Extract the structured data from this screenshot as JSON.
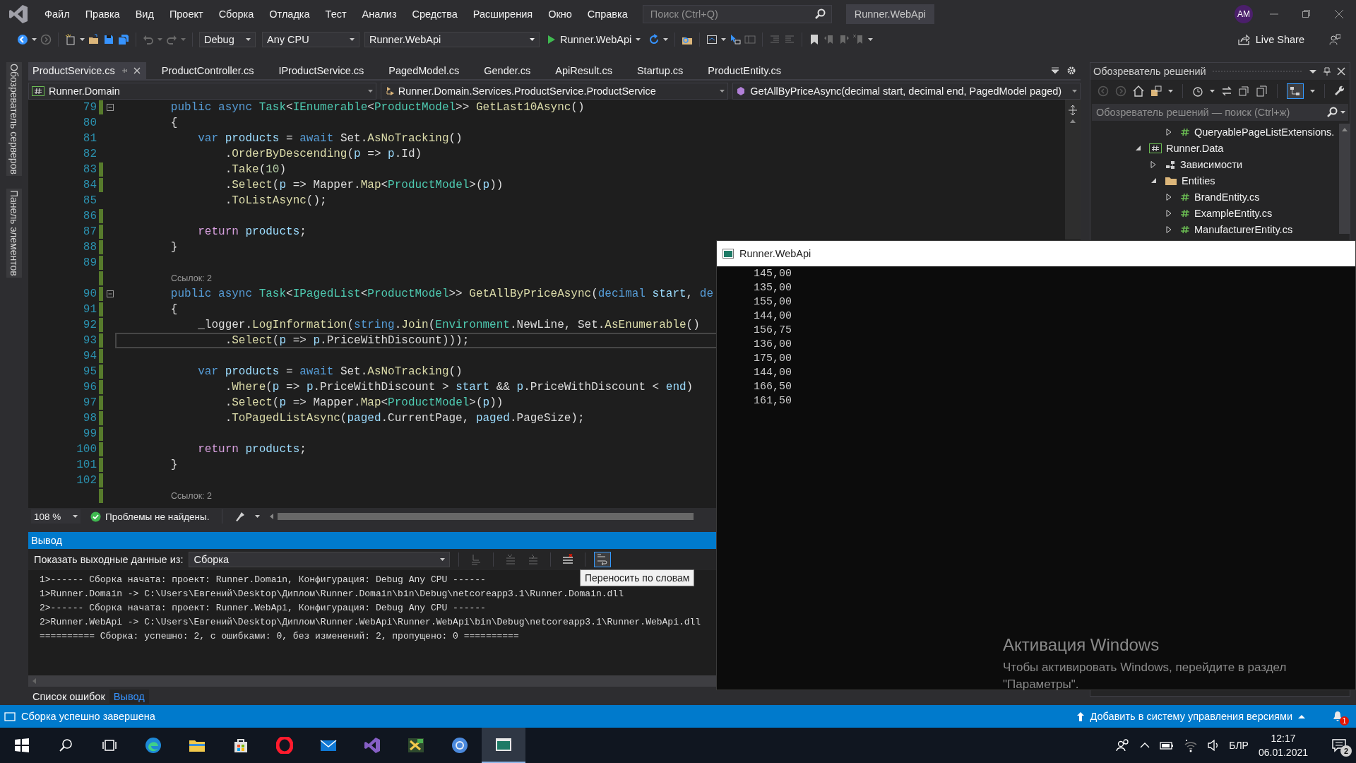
{
  "menu_bar": {
    "items": [
      "Файл",
      "Правка",
      "Вид",
      "Проект",
      "Сборка",
      "Отладка",
      "Тест",
      "Анализ",
      "Средства",
      "Расширения",
      "Окно",
      "Справка"
    ],
    "search": {
      "placeholder": "Поиск (Ctrl+Q)"
    },
    "solution_name": "Runner.WebApi",
    "avatar": "AM"
  },
  "toolbar": {
    "configuration": "Debug",
    "platform": "Any CPU",
    "startup_project": "Runner.WebApi",
    "run_target": "Runner.WebApi",
    "live_share": "Live Share"
  },
  "side_strip": [
    "Обозреватель серверов",
    "Панель элементов"
  ],
  "editor": {
    "tabs": [
      {
        "label": "ProductService.cs",
        "selected": true
      },
      {
        "label": "ProductController.cs",
        "selected": false
      },
      {
        "label": "IProductService.cs",
        "selected": false
      },
      {
        "label": "PagedModel.cs",
        "selected": false
      },
      {
        "label": "Gender.cs",
        "selected": false
      },
      {
        "label": "ApiResult.cs",
        "selected": false
      },
      {
        "label": "Startup.cs",
        "selected": false
      },
      {
        "label": "ProductEntity.cs",
        "selected": false
      }
    ],
    "nav": {
      "project": "Runner.Domain",
      "type": "Runner.Domain.Services.ProductService.ProductService",
      "member": "GetAllByPriceAsync(decimal start, decimal end, PagedModel paged)"
    },
    "lines": [
      {
        "kind": "code",
        "number": "79",
        "changed": true,
        "current": false,
        "foldable": true,
        "tokens": [
          {
            "kind": "kw",
            "text": "        public"
          },
          {
            "kind": "kw",
            "text": " async"
          },
          {
            "kind": "type",
            "text": " Task"
          },
          {
            "kind": "plain",
            "text": "<"
          },
          {
            "kind": "type",
            "text": "IEnumerable"
          },
          {
            "kind": "plain",
            "text": "<"
          },
          {
            "kind": "type",
            "text": "ProductModel"
          },
          {
            "kind": "plain",
            "text": ">> "
          },
          {
            "kind": "method",
            "text": "GetLast10Async"
          },
          {
            "kind": "plain",
            "text": "()"
          }
        ]
      },
      {
        "kind": "code",
        "number": "80",
        "changed": false,
        "current": false,
        "foldable": false,
        "tokens": [
          {
            "kind": "plain",
            "text": "        {"
          }
        ]
      },
      {
        "kind": "code",
        "number": "81",
        "changed": false,
        "current": false,
        "foldable": false,
        "tokens": [
          {
            "kind": "kw",
            "text": "            var"
          },
          {
            "kind": "ident",
            "text": " products"
          },
          {
            "kind": "plain",
            "text": " = "
          },
          {
            "kind": "kw",
            "text": "await"
          },
          {
            "kind": "plain",
            "text": " Set."
          },
          {
            "kind": "method",
            "text": "AsNoTracking"
          },
          {
            "kind": "plain",
            "text": "()"
          }
        ]
      },
      {
        "kind": "code",
        "number": "82",
        "changed": false,
        "current": false,
        "foldable": false,
        "tokens": [
          {
            "kind": "plain",
            "text": "                ."
          },
          {
            "kind": "method",
            "text": "OrderByDescending"
          },
          {
            "kind": "plain",
            "text": "("
          },
          {
            "kind": "ident",
            "text": "p"
          },
          {
            "kind": "plain",
            "text": " => "
          },
          {
            "kind": "ident",
            "text": "p"
          },
          {
            "kind": "plain",
            "text": ".Id)"
          }
        ]
      },
      {
        "kind": "code",
        "number": "83",
        "changed": true,
        "current": false,
        "foldable": false,
        "tokens": [
          {
            "kind": "plain",
            "text": "                ."
          },
          {
            "kind": "method",
            "text": "Take"
          },
          {
            "kind": "plain",
            "text": "("
          },
          {
            "kind": "num",
            "text": "10"
          },
          {
            "kind": "plain",
            "text": ")"
          }
        ]
      },
      {
        "kind": "code",
        "number": "84",
        "changed": true,
        "current": false,
        "foldable": false,
        "tokens": [
          {
            "kind": "plain",
            "text": "                ."
          },
          {
            "kind": "method",
            "text": "Select"
          },
          {
            "kind": "plain",
            "text": "("
          },
          {
            "kind": "ident",
            "text": "p"
          },
          {
            "kind": "plain",
            "text": " => Mapper."
          },
          {
            "kind": "method",
            "text": "Map"
          },
          {
            "kind": "plain",
            "text": "<"
          },
          {
            "kind": "type",
            "text": "ProductModel"
          },
          {
            "kind": "plain",
            "text": ">("
          },
          {
            "kind": "ident",
            "text": "p"
          },
          {
            "kind": "plain",
            "text": "))"
          }
        ]
      },
      {
        "kind": "code",
        "number": "85",
        "changed": false,
        "current": false,
        "foldable": false,
        "tokens": [
          {
            "kind": "plain",
            "text": "                ."
          },
          {
            "kind": "method",
            "text": "ToListAsync"
          },
          {
            "kind": "plain",
            "text": "();"
          }
        ]
      },
      {
        "kind": "code",
        "number": "86",
        "changed": true,
        "current": false,
        "foldable": false
      },
      {
        "kind": "code",
        "number": "87",
        "changed": true,
        "current": false,
        "foldable": false,
        "tokens": [
          {
            "kind": "ctl",
            "text": "            return"
          },
          {
            "kind": "ident",
            "text": " products"
          },
          {
            "kind": "plain",
            "text": ";"
          }
        ]
      },
      {
        "kind": "code",
        "number": "88",
        "changed": true,
        "current": false,
        "foldable": false,
        "tokens": [
          {
            "kind": "plain",
            "text": "        }"
          }
        ]
      },
      {
        "kind": "code",
        "number": "89",
        "changed": true,
        "current": false,
        "foldable": false
      },
      {
        "kind": "codelens",
        "text": "Ссылок: 2"
      },
      {
        "kind": "code",
        "number": "90",
        "changed": true,
        "current": false,
        "foldable": true,
        "tokens": [
          {
            "kind": "kw",
            "text": "        public"
          },
          {
            "kind": "kw",
            "text": " async"
          },
          {
            "kind": "type",
            "text": " Task"
          },
          {
            "kind": "plain",
            "text": "<"
          },
          {
            "kind": "type",
            "text": "IPagedList"
          },
          {
            "kind": "plain",
            "text": "<"
          },
          {
            "kind": "type",
            "text": "ProductModel"
          },
          {
            "kind": "plain",
            "text": ">> "
          },
          {
            "kind": "method",
            "text": "GetAllByPriceAsync"
          },
          {
            "kind": "plain",
            "text": "("
          },
          {
            "kind": "kw",
            "text": "decimal"
          },
          {
            "kind": "ident",
            "text": " start"
          },
          {
            "kind": "plain",
            "text": ", "
          },
          {
            "kind": "kw",
            "text": "de"
          }
        ]
      },
      {
        "kind": "code",
        "number": "91",
        "changed": true,
        "current": false,
        "foldable": false,
        "tokens": [
          {
            "kind": "plain",
            "text": "        {"
          }
        ]
      },
      {
        "kind": "code",
        "number": "92",
        "changed": true,
        "current": false,
        "foldable": false,
        "tokens": [
          {
            "kind": "plain",
            "text": "            _logger."
          },
          {
            "kind": "method",
            "text": "LogInformation"
          },
          {
            "kind": "plain",
            "text": "("
          },
          {
            "kind": "kw",
            "text": "string"
          },
          {
            "kind": "plain",
            "text": "."
          },
          {
            "kind": "method",
            "text": "Join"
          },
          {
            "kind": "plain",
            "text": "("
          },
          {
            "kind": "type",
            "text": "Environment"
          },
          {
            "kind": "plain",
            "text": ".NewLine, Set."
          },
          {
            "kind": "method",
            "text": "AsEnumerable"
          },
          {
            "kind": "plain",
            "text": "()"
          }
        ]
      },
      {
        "kind": "code",
        "number": "93",
        "changed": true,
        "current": true,
        "foldable": false,
        "tokens": [
          {
            "kind": "plain",
            "text": "                ."
          },
          {
            "kind": "method",
            "text": "Select"
          },
          {
            "kind": "plain",
            "text": "("
          },
          {
            "kind": "ident",
            "text": "p"
          },
          {
            "kind": "plain",
            "text": " => "
          },
          {
            "kind": "ident",
            "text": "p"
          },
          {
            "kind": "plain",
            "text": ".PriceWithDiscount)));"
          }
        ]
      },
      {
        "kind": "code",
        "number": "94",
        "changed": true,
        "current": false,
        "foldable": false
      },
      {
        "kind": "code",
        "number": "95",
        "changed": true,
        "current": false,
        "foldable": false,
        "tokens": [
          {
            "kind": "kw",
            "text": "            var"
          },
          {
            "kind": "ident",
            "text": " products"
          },
          {
            "kind": "plain",
            "text": " = "
          },
          {
            "kind": "kw",
            "text": "await"
          },
          {
            "kind": "plain",
            "text": " Set."
          },
          {
            "kind": "method",
            "text": "AsNoTracking"
          },
          {
            "kind": "plain",
            "text": "()"
          }
        ]
      },
      {
        "kind": "code",
        "number": "96",
        "changed": true,
        "current": false,
        "foldable": false,
        "tokens": [
          {
            "kind": "plain",
            "text": "                ."
          },
          {
            "kind": "method",
            "text": "Where"
          },
          {
            "kind": "plain",
            "text": "("
          },
          {
            "kind": "ident",
            "text": "p"
          },
          {
            "kind": "plain",
            "text": " => "
          },
          {
            "kind": "ident",
            "text": "p"
          },
          {
            "kind": "plain",
            "text": ".PriceWithDiscount > "
          },
          {
            "kind": "ident",
            "text": "start"
          },
          {
            "kind": "plain",
            "text": " && "
          },
          {
            "kind": "ident",
            "text": "p"
          },
          {
            "kind": "plain",
            "text": ".PriceWithDiscount < "
          },
          {
            "kind": "ident",
            "text": "end"
          },
          {
            "kind": "plain",
            "text": ")"
          }
        ]
      },
      {
        "kind": "code",
        "number": "97",
        "changed": true,
        "current": false,
        "foldable": false,
        "tokens": [
          {
            "kind": "plain",
            "text": "                ."
          },
          {
            "kind": "method",
            "text": "Select"
          },
          {
            "kind": "plain",
            "text": "("
          },
          {
            "kind": "ident",
            "text": "p"
          },
          {
            "kind": "plain",
            "text": " => Mapper."
          },
          {
            "kind": "method",
            "text": "Map"
          },
          {
            "kind": "plain",
            "text": "<"
          },
          {
            "kind": "type",
            "text": "ProductModel"
          },
          {
            "kind": "plain",
            "text": ">("
          },
          {
            "kind": "ident",
            "text": "p"
          },
          {
            "kind": "plain",
            "text": "))"
          }
        ]
      },
      {
        "kind": "code",
        "number": "98",
        "changed": true,
        "current": false,
        "foldable": false,
        "tokens": [
          {
            "kind": "plain",
            "text": "                ."
          },
          {
            "kind": "method",
            "text": "ToPagedListAsync"
          },
          {
            "kind": "plain",
            "text": "("
          },
          {
            "kind": "ident",
            "text": "paged"
          },
          {
            "kind": "plain",
            "text": ".CurrentPage, "
          },
          {
            "kind": "ident",
            "text": "paged"
          },
          {
            "kind": "plain",
            "text": ".PageSize);"
          }
        ]
      },
      {
        "kind": "code",
        "number": "99",
        "changed": true,
        "current": false,
        "foldable": false
      },
      {
        "kind": "code",
        "number": "100",
        "changed": true,
        "current": false,
        "foldable": false,
        "tokens": [
          {
            "kind": "ctl",
            "text": "            return"
          },
          {
            "kind": "ident",
            "text": " products"
          },
          {
            "kind": "plain",
            "text": ";"
          }
        ]
      },
      {
        "kind": "code",
        "number": "101",
        "changed": true,
        "current": false,
        "foldable": false,
        "tokens": [
          {
            "kind": "plain",
            "text": "        }"
          }
        ]
      },
      {
        "kind": "code",
        "number": "102",
        "changed": true,
        "current": false,
        "foldable": false
      },
      {
        "kind": "codelens",
        "text": "Ссылок: 2"
      }
    ],
    "zoom": "108 %",
    "issues": "Проблемы не найдены."
  },
  "output": {
    "title": "Вывод",
    "source_label": "Показать выходные данные из:",
    "source": "Сборка",
    "wrap_button_hovered": true,
    "tooltip": "Переносить по словам",
    "lines": [
      "1>------ Сборка начата: проект: Runner.Domain, Конфигурация: Debug Any CPU ------",
      "1>Runner.Domain -> C:\\Users\\Евгений\\Desktop\\Диплом\\Runner.Domain\\bin\\Debug\\netcoreapp3.1\\Runner.Domain.dll",
      "2>------ Сборка начата: проект: Runner.WebApi, Конфигурация: Debug Any CPU ------",
      "2>Runner.WebApi -> C:\\Users\\Евгений\\Desktop\\Диплом\\Runner.WebApi\\Runner.WebApi\\bin\\Debug\\netcoreapp3.1\\Runner.WebApi.dll",
      "========== Сборка: успешно: 2, с ошибками: 0, без изменений: 2, пропущено: 0 =========="
    ]
  },
  "bottom_tabs": [
    {
      "label": "Список ошибок",
      "selected": false
    },
    {
      "label": "Вывод",
      "selected": true
    }
  ],
  "solution_explorer": {
    "title": "Обозреватель решений",
    "search": {
      "placeholder": "Обозреватель решений — поиск (Ctrl+ж)"
    },
    "tree": [
      {
        "children": [
          {
            "children": [
              {
                "label": "QueryablePageListExtensions.",
                "kind": "cs-file",
                "expanded": false
              }
            ]
          }
        ]
      },
      {
        "label": "Runner.Data",
        "kind": "project",
        "expanded": true,
        "children": [
          {
            "label": "Зависимости",
            "kind": "dependencies",
            "expanded": false
          },
          {
            "label": "Entities",
            "kind": "folder",
            "expanded": true,
            "children": [
              {
                "label": "BrandEntity.cs",
                "kind": "cs-file",
                "expanded": false
              },
              {
                "label": "ExampleEntity.cs",
                "kind": "cs-file",
                "expanded": false
              },
              {
                "label": "ManufacturerEntity.cs",
                "kind": "cs-file",
                "expanded": false
              }
            ]
          }
        ]
      }
    ]
  },
  "console": {
    "title": "Runner.WebApi",
    "lines": [
      "145,00",
      "135,00",
      "155,00",
      "144,00",
      "156,75",
      "136,00",
      "175,00",
      "144,00",
      "166,50",
      "161,50"
    ]
  },
  "activation": {
    "title": "Активация Windows",
    "message_lines": [
      "Чтобы активировать Windows, перейдите в раздел",
      "\"Параметры\"."
    ]
  },
  "status_bar": {
    "message": "Сборка успешно завершена",
    "source_control": "Добавить в систему управления версиями",
    "notifications": "1"
  },
  "taskbar": {
    "apps": [
      {
        "kind": "edge",
        "active": false
      },
      {
        "kind": "explorer",
        "active": false
      },
      {
        "kind": "store",
        "active": false
      },
      {
        "kind": "opera",
        "active": false
      },
      {
        "kind": "mail",
        "active": false
      },
      {
        "kind": "visual-studio",
        "active": false
      },
      {
        "kind": "designer",
        "active": false
      },
      {
        "kind": "chrome",
        "active": false
      },
      {
        "kind": "console",
        "active": true
      }
    ],
    "language": "БЛР",
    "time": "12:17",
    "date": "06.01.2021",
    "notifications": "2"
  }
}
